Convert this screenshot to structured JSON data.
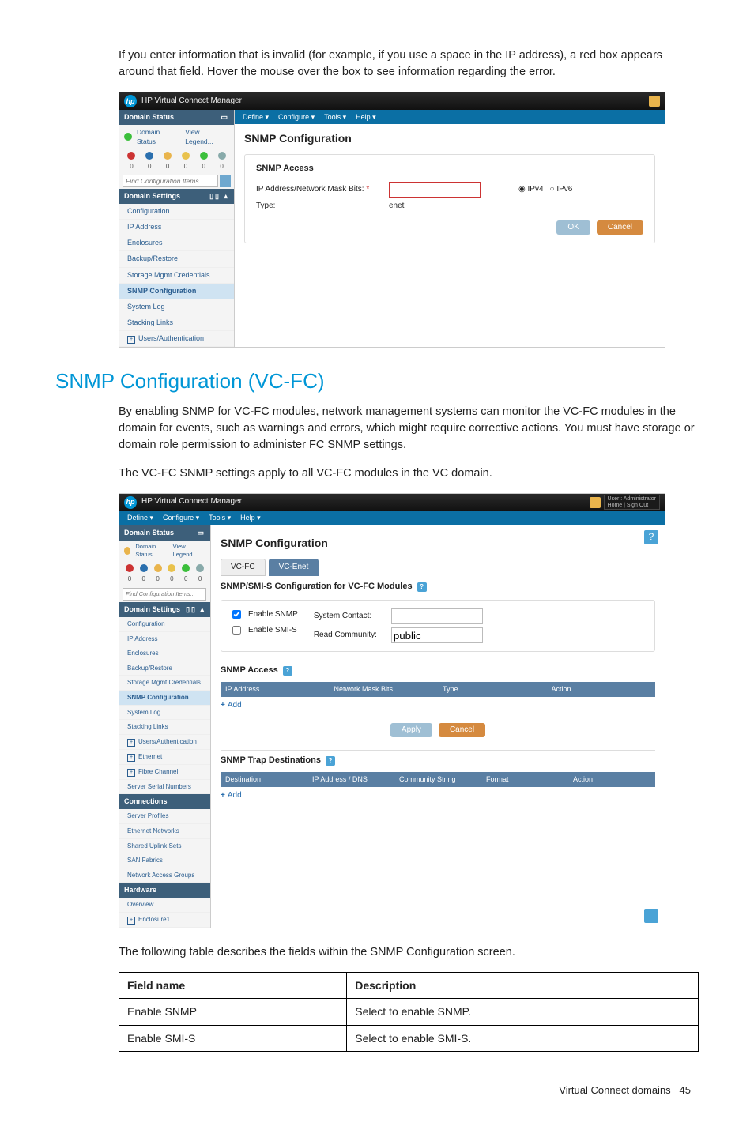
{
  "intro_para": "If you enter information that is invalid (for example, if you use a space in the IP address), a red box appears around that field. Hover the mouse over the box to see information regarding the error.",
  "section_heading": "SNMP Configuration (VC-FC)",
  "section_para1": "By enabling SNMP for VC-FC modules, network management systems can monitor the VC-FC modules in the domain for events, such as warnings and errors, which might require corrective actions. You must have storage or domain role permission to administer FC SNMP settings.",
  "section_para2": "The VC-FC SNMP settings apply to all VC-FC modules in the VC domain.",
  "table_intro": "The following table describes the fields within the SNMP Configuration screen.",
  "desc_table": {
    "headers": [
      "Field name",
      "Description"
    ],
    "rows": [
      [
        "Enable SNMP",
        "Select to enable SNMP."
      ],
      [
        "Enable SMI-S",
        "Select to enable SMI-S."
      ]
    ]
  },
  "footer": {
    "text": "Virtual Connect domains",
    "page": "45"
  },
  "shot1": {
    "app_title": "HP Virtual Connect Manager",
    "menus": [
      "Define",
      "Configure",
      "Tools",
      "Help"
    ],
    "side": {
      "domain_status_hdr": "Domain Status",
      "status_link": "Domain Status",
      "view_legend": "View Legend...",
      "status_icons": [
        {
          "bg": "#c33"
        },
        {
          "bg": "#2a6fae"
        },
        {
          "bg": "#e9b44c"
        },
        {
          "bg": "#e9c24c"
        },
        {
          "bg": "#3bbf3b"
        },
        {
          "bg": "#8aa"
        }
      ],
      "counts": [
        "0",
        "0",
        "0",
        "0",
        "0",
        "0"
      ],
      "search_placeholder": "Find Configuration Items...",
      "settings_hdr": "Domain Settings",
      "items": [
        {
          "label": "Configuration"
        },
        {
          "label": "IP Address"
        },
        {
          "label": "Enclosures"
        },
        {
          "label": "Backup/Restore"
        },
        {
          "label": "Storage Mgmt Credentials"
        },
        {
          "label": "SNMP Configuration",
          "sel": true
        },
        {
          "label": "System Log"
        },
        {
          "label": "Stacking Links"
        },
        {
          "label": "Users/Authentication",
          "plus": true
        }
      ]
    },
    "main": {
      "title": "SNMP Configuration",
      "card_title": "SNMP Access",
      "ip_label": "IP Address/Network Mask Bits:",
      "ip_required": "*",
      "type_label": "Type:",
      "type_value": "enet",
      "radio1": "IPv4",
      "radio2": "IPv6",
      "ok": "OK",
      "cancel": "Cancel"
    }
  },
  "shot2": {
    "app_title": "HP Virtual Connect Manager",
    "user_line1": "User : Administrator",
    "user_line2": "Home | Sign Out",
    "menus": [
      "Define",
      "Configure",
      "Tools",
      "Help"
    ],
    "side": {
      "domain_status_hdr": "Domain Status",
      "status_link": "Domain Status",
      "view_legend": "View Legend...",
      "counts": [
        "0",
        "0",
        "0",
        "0",
        "0",
        "0"
      ],
      "search_placeholder": "Find Configuration Items...",
      "settings_hdr": "Domain Settings",
      "items": [
        {
          "label": "Configuration"
        },
        {
          "label": "IP Address"
        },
        {
          "label": "Enclosures"
        },
        {
          "label": "Backup/Restore"
        },
        {
          "label": "Storage Mgmt Credentials"
        },
        {
          "label": "SNMP Configuration",
          "sel": true
        },
        {
          "label": "System Log"
        },
        {
          "label": "Stacking Links"
        },
        {
          "label": "Users/Authentication",
          "plus": true
        },
        {
          "label": "Ethernet",
          "plus": true
        },
        {
          "label": "Fibre Channel",
          "plus": true
        },
        {
          "label": "Server Serial Numbers"
        }
      ],
      "connections_hdr": "Connections",
      "conn_items": [
        {
          "label": "Server Profiles"
        },
        {
          "label": "Ethernet Networks"
        },
        {
          "label": "Shared Uplink Sets"
        },
        {
          "label": "SAN Fabrics"
        },
        {
          "label": "Network Access Groups"
        }
      ],
      "hardware_hdr": "Hardware",
      "hw_items": [
        {
          "label": "Overview"
        },
        {
          "label": "Enclosure1",
          "plus": true
        }
      ]
    },
    "main": {
      "title": "SNMP Configuration",
      "tab1": "VC-FC",
      "tab2": "VC-Enet",
      "subt1": "SNMP/SMI-S Configuration for VC-FC Modules",
      "chk1": "Enable SNMP",
      "chk2": "Enable SMI-S",
      "sc_label": "System Contact:",
      "rc_label": "Read Community:",
      "rc_value": "public",
      "access_title": "SNMP Access",
      "access_cols": [
        "IP Address",
        "Network Mask Bits",
        "Type",
        "Action"
      ],
      "add": "Add",
      "apply": "Apply",
      "cancel": "Cancel",
      "trap_title": "SNMP Trap Destinations",
      "trap_cols": [
        "Destination",
        "IP Address / DNS",
        "Community String",
        "Format",
        "Action"
      ]
    }
  }
}
